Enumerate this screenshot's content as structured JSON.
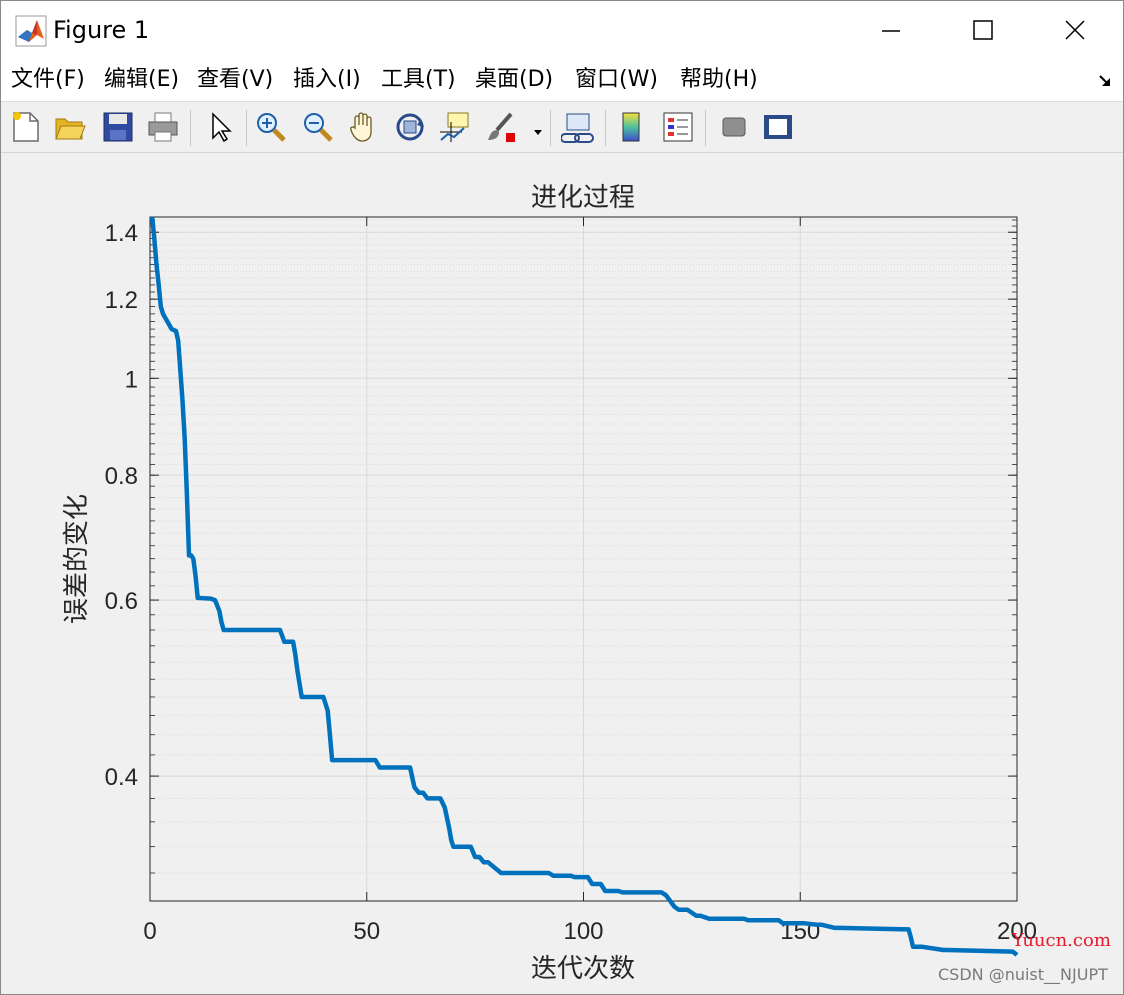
{
  "window": {
    "title": "Figure 1"
  },
  "menu": [
    {
      "label": "文件(F)"
    },
    {
      "label": "编辑(E)"
    },
    {
      "label": "查看(V)"
    },
    {
      "label": "插入(I)"
    },
    {
      "label": "工具(T)"
    },
    {
      "label": "桌面(D)"
    },
    {
      "label": "窗口(W)"
    },
    {
      "label": "帮助(H)"
    }
  ],
  "toolbar_icons": [
    "new-figure-icon",
    "open-file-icon",
    "save-icon",
    "print-icon",
    "select-arrow-icon",
    "zoom-in-icon",
    "zoom-out-icon",
    "pan-hand-icon",
    "rotate-3d-icon",
    "data-cursor-icon",
    "brush-icon",
    "link-plot-icon",
    "colorbar-icon",
    "legend-icon",
    "hide-plot-tools-icon",
    "show-plot-tools-icon"
  ],
  "colors": {
    "line": "#0072bd",
    "brush_red": "#e00000",
    "grid": "#d9d9d9",
    "axes_text": "#262626"
  },
  "chart_data": {
    "type": "line",
    "title": "进化过程",
    "xlabel": "迭代次数",
    "ylabel": "误差的变化",
    "xlim": [
      0,
      200
    ],
    "ylim": [
      0.3,
      1.45
    ],
    "yscale": "log",
    "grid": true,
    "minor_grid": true,
    "xticks": [
      0,
      50,
      100,
      150,
      200
    ],
    "xtick_labels": [
      "0",
      "50",
      "100",
      "150",
      "200"
    ],
    "yticks": [
      0.4,
      0.6,
      0.8,
      1,
      1.2,
      1.4
    ],
    "ytick_labels": [
      "0.4",
      "0.6",
      "0.8",
      "1",
      "1.2",
      "1.4"
    ],
    "series": [
      {
        "x": [
          0.5,
          1,
          1.5,
          2,
          2.5,
          3,
          4,
          5,
          6,
          6.5,
          7,
          7.5,
          8,
          8.5,
          9,
          9.5,
          10,
          10.5,
          11,
          14,
          15,
          16,
          16.5,
          17,
          30,
          31,
          33,
          33.5,
          34,
          35,
          40,
          41,
          41.5,
          42,
          52,
          53,
          60,
          61,
          62,
          63,
          64,
          67,
          68,
          69,
          69.5,
          70,
          74,
          75,
          76,
          77,
          78,
          81,
          82,
          92,
          93,
          97,
          98,
          101,
          102,
          104,
          105,
          108,
          109,
          118,
          119,
          120,
          121,
          122,
          124,
          126,
          127,
          129,
          130,
          137,
          138,
          145,
          146,
          150,
          151,
          154,
          155,
          158,
          159,
          175,
          175.5,
          176,
          177,
          178,
          183,
          184,
          199,
          199.5,
          200
        ],
        "y": [
          1.45,
          1.38,
          1.3,
          1.24,
          1.18,
          1.16,
          1.14,
          1.12,
          1.115,
          1.09,
          1.02,
          0.95,
          0.87,
          0.77,
          0.665,
          0.665,
          0.66,
          0.635,
          0.603,
          0.602,
          0.6,
          0.585,
          0.57,
          0.56,
          0.56,
          0.545,
          0.545,
          0.53,
          0.51,
          0.48,
          0.48,
          0.465,
          0.44,
          0.415,
          0.415,
          0.408,
          0.408,
          0.39,
          0.385,
          0.385,
          0.38,
          0.38,
          0.372,
          0.355,
          0.345,
          0.34,
          0.34,
          0.332,
          0.332,
          0.328,
          0.328,
          0.32,
          0.32,
          0.32,
          0.318,
          0.318,
          0.317,
          0.317,
          0.312,
          0.312,
          0.307,
          0.307,
          0.306,
          0.306,
          0.304,
          0.3,
          0.296,
          0.294,
          0.294,
          0.29,
          0.29,
          0.288,
          0.288,
          0.288,
          0.287,
          0.287,
          0.285,
          0.285,
          0.285,
          0.284,
          0.284,
          0.282,
          0.282,
          0.281,
          0.276,
          0.27,
          0.27,
          0.27,
          0.268,
          0.268,
          0.267,
          0.266,
          0.265
        ]
      }
    ]
  },
  "watermarks": {
    "yuucn": "Yuucn.com",
    "csdn": "CSDN @nuist__NJUPT"
  }
}
